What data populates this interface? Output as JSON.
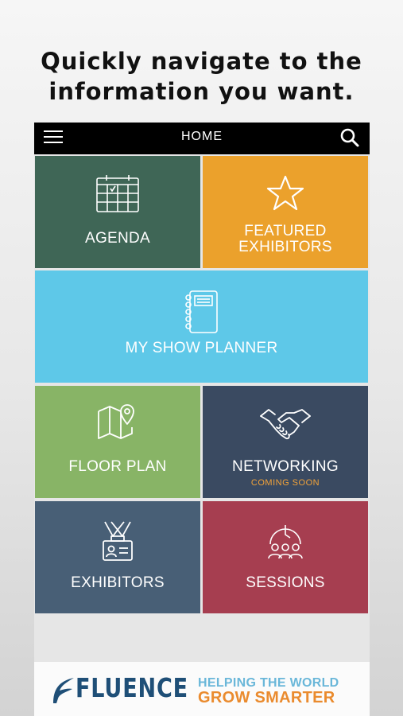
{
  "headline": {
    "line1": "Quickly navigate to the",
    "line2": "information you want."
  },
  "topbar": {
    "title": "HOME",
    "menu_icon": "hamburger-menu-icon",
    "search_icon": "search-icon"
  },
  "tiles": [
    {
      "label": "AGENDA",
      "icon": "calendar-icon",
      "color": "#3f6656"
    },
    {
      "label_line1": "FEATURED",
      "label_line2": "EXHIBITORS",
      "icon": "star-icon",
      "color": "#eba12c"
    },
    {
      "label": "MY SHOW PLANNER",
      "icon": "notebook-icon",
      "color": "#5ec8e8"
    },
    {
      "label": "FLOOR PLAN",
      "icon": "map-pin-icon",
      "color": "#88b466"
    },
    {
      "label": "NETWORKING",
      "sublabel": "COMING SOON",
      "icon": "handshake-icon",
      "color": "#3a4a61"
    },
    {
      "label": "EXHIBITORS",
      "icon": "badge-icon",
      "color": "#485f76"
    },
    {
      "label": "SESSIONS",
      "icon": "clock-people-icon",
      "color": "#a63e50"
    }
  ],
  "banner": {
    "brand": "FLUENCE",
    "tagline_line1": "HELPING THE WORLD",
    "tagline_line2": "GROW SMARTER",
    "colors": {
      "brand": "#1f4f77",
      "tag1": "#6ab7d9",
      "tag2": "#ea8b2e"
    }
  }
}
